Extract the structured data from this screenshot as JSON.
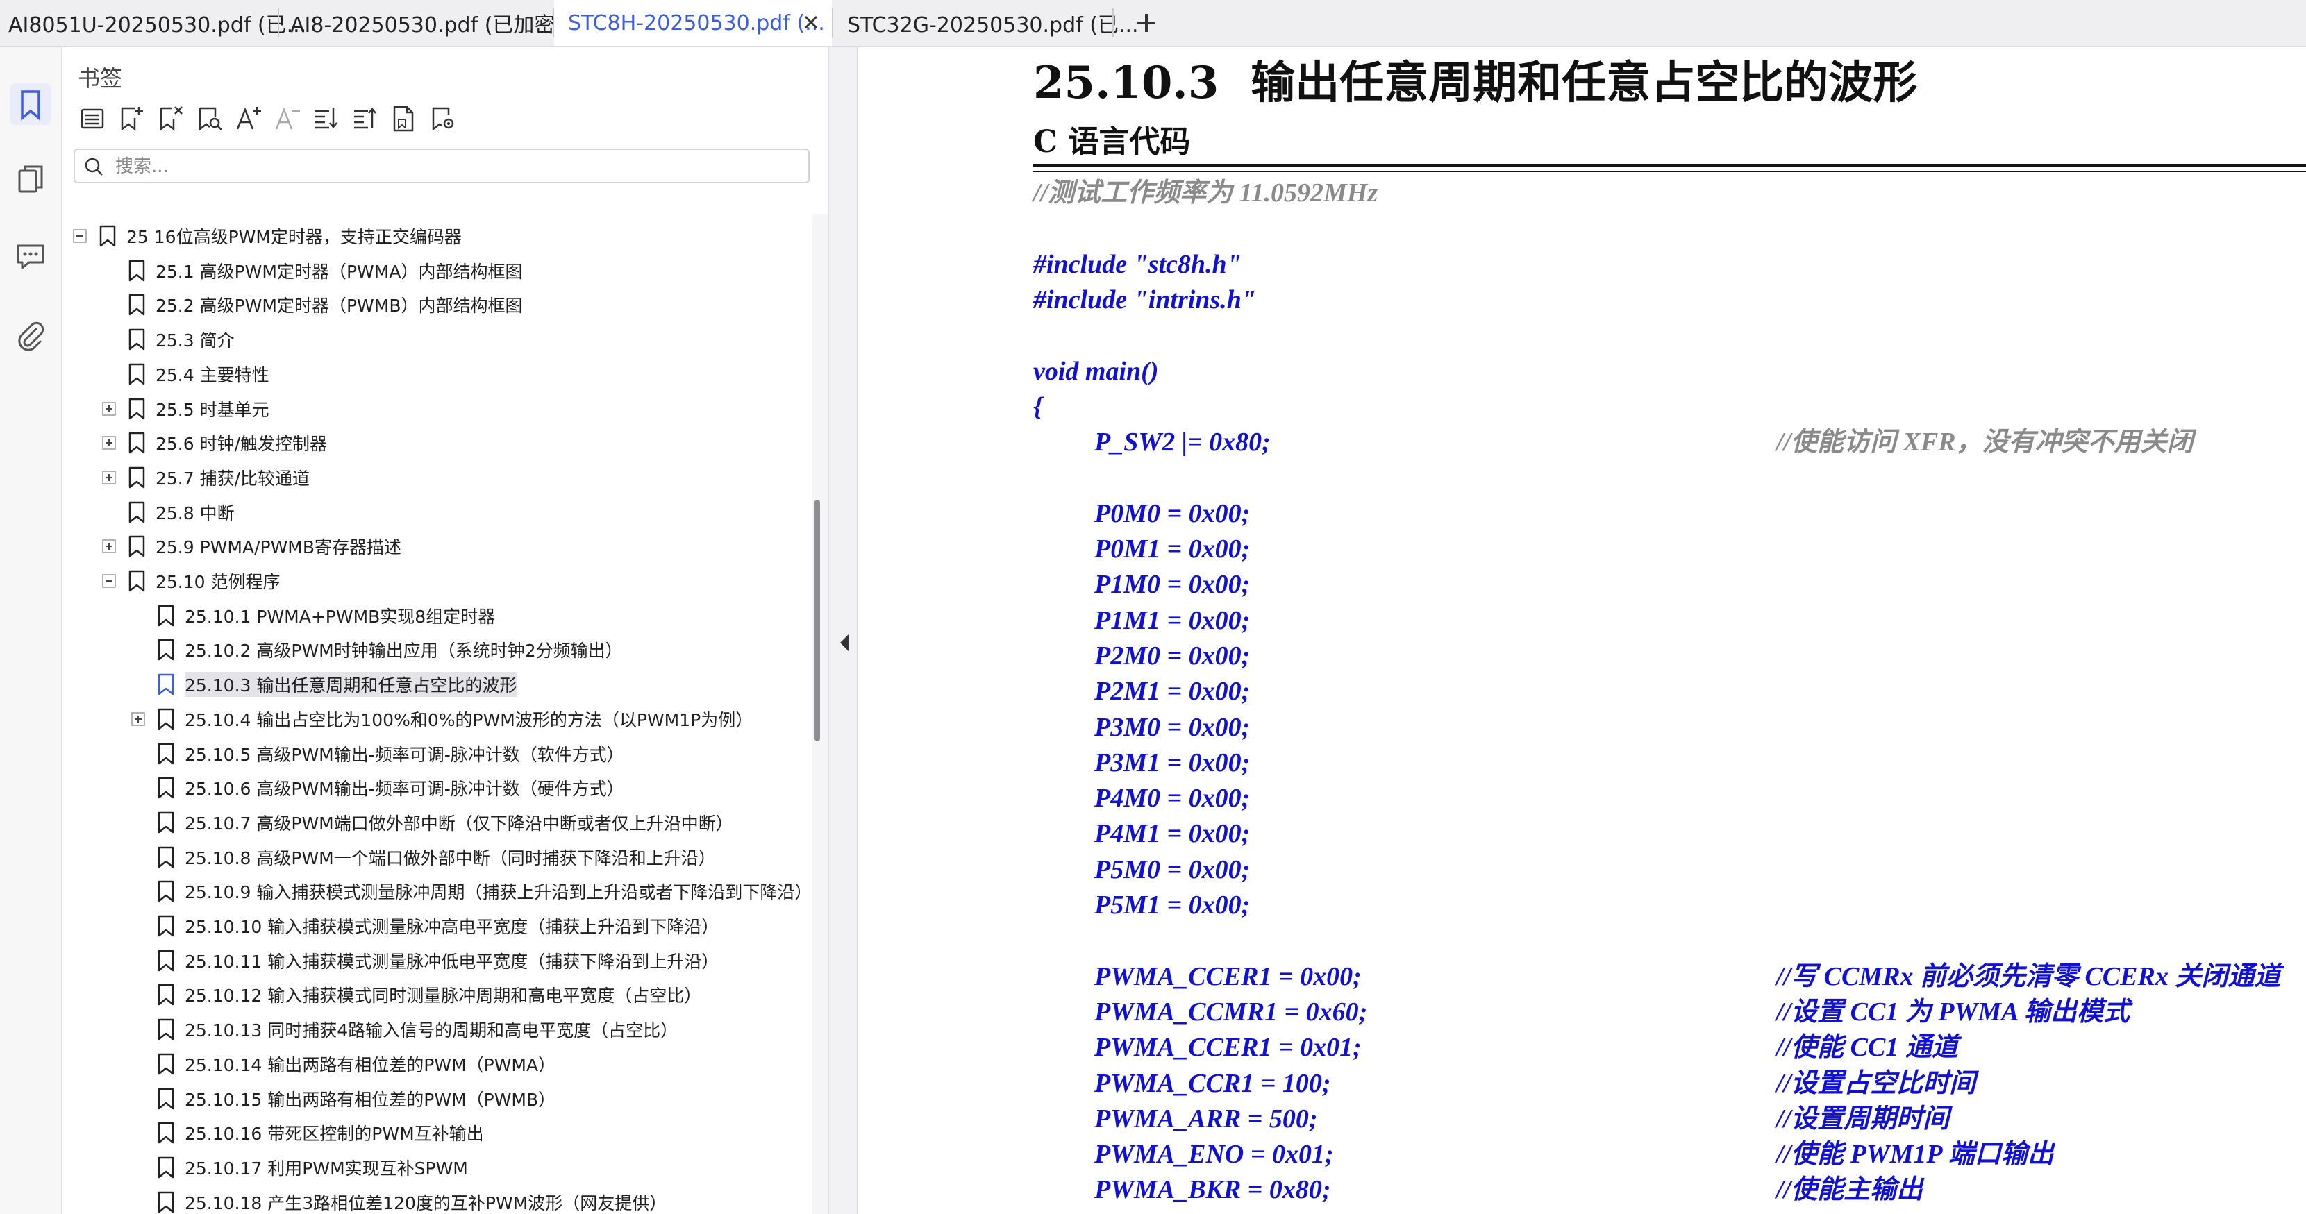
{
  "tabs": [
    {
      "label": "AI8051U-20250530.pdf (已...",
      "active": false
    },
    {
      "label": "AI8-20250530.pdf (已加密)",
      "active": false
    },
    {
      "label": "STC8H-20250530.pdf (...",
      "active": true
    },
    {
      "label": "STC32G-20250530.pdf (已..."
    }
  ],
  "sidebar": {
    "title": "书签",
    "search_placeholder": "搜索...",
    "tools": [
      "list-icon",
      "add-bookmark-icon",
      "delete-bookmark-icon",
      "find-bookmark-icon",
      "font-increase-icon",
      "font-decrease-icon",
      "expand-all-icon",
      "collapse-all-icon",
      "bookmark-page-icon",
      "bookmark-settings-icon"
    ],
    "rail": [
      "bookmark-icon",
      "pages-icon",
      "comments-icon",
      "attachment-icon"
    ],
    "items": [
      {
        "label": "25  16位高级PWM定时器，支持正交编码器",
        "level": 0,
        "expander": "minus"
      },
      {
        "label": "25.1  高级PWM定时器（PWMA）内部结构框图",
        "level": 1,
        "expander": ""
      },
      {
        "label": "25.2  高级PWM定时器（PWMB）内部结构框图",
        "level": 1,
        "expander": ""
      },
      {
        "label": "25.3  简介",
        "level": 1,
        "expander": ""
      },
      {
        "label": "25.4  主要特性",
        "level": 1,
        "expander": ""
      },
      {
        "label": "25.5  时基单元",
        "level": 1,
        "expander": "plus"
      },
      {
        "label": "25.6 时钟/触发控制器",
        "level": 1,
        "expander": "plus"
      },
      {
        "label": "25.7 捕获/比较通道",
        "level": 1,
        "expander": "plus"
      },
      {
        "label": "25.8 中断",
        "level": 1,
        "expander": ""
      },
      {
        "label": "25.9  PWMA/PWMB寄存器描述",
        "level": 1,
        "expander": "plus"
      },
      {
        "label": "25.10  范例程序",
        "level": 1,
        "expander": "minus"
      },
      {
        "label": "25.10.1 PWMA+PWMB实现8组定时器",
        "level": 2,
        "expander": ""
      },
      {
        "label": "25.10.2 高级PWM时钟输出应用（系统时钟2分频输出）",
        "level": 2,
        "expander": ""
      },
      {
        "label": "25.10.3 输出任意周期和任意占空比的波形",
        "level": 2,
        "expander": "",
        "selected": true
      },
      {
        "label": "25.10.4 输出占空比为100%和0%的PWM波形的方法（以PWM1P为例）",
        "level": 2,
        "expander": "plus"
      },
      {
        "label": "25.10.5 高级PWM输出-频率可调-脉冲计数（软件方式）",
        "level": 2,
        "expander": ""
      },
      {
        "label": "25.10.6 高级PWM输出-频率可调-脉冲计数（硬件方式）",
        "level": 2,
        "expander": ""
      },
      {
        "label": "25.10.7 高级PWM端口做外部中断（仅下降沿中断或者仅上升沿中断）",
        "level": 2,
        "expander": ""
      },
      {
        "label": "25.10.8  高级PWM一个端口做外部中断（同时捕获下降沿和上升沿）",
        "level": 2,
        "expander": ""
      },
      {
        "label": "25.10.9  输入捕获模式测量脉冲周期（捕获上升沿到上升沿或者下降沿到下降沿）",
        "level": 2,
        "expander": ""
      },
      {
        "label": "25.10.10 输入捕获模式测量脉冲高电平宽度（捕获上升沿到下降沿）",
        "level": 2,
        "expander": ""
      },
      {
        "label": "25.10.11 输入捕获模式测量脉冲低电平宽度（捕获下降沿到上升沿）",
        "level": 2,
        "expander": ""
      },
      {
        "label": "25.10.12 输入捕获模式同时测量脉冲周期和高电平宽度（占空比）",
        "level": 2,
        "expander": ""
      },
      {
        "label": "25.10.13 同时捕获4路输入信号的周期和高电平宽度（占空比）",
        "level": 2,
        "expander": ""
      },
      {
        "label": "25.10.14 输出两路有相位差的PWM（PWMA）",
        "level": 2,
        "expander": ""
      },
      {
        "label": "25.10.15 输出两路有相位差的PWM（PWMB）",
        "level": 2,
        "expander": ""
      },
      {
        "label": "25.10.16 带死区控制的PWM互补输出",
        "level": 2,
        "expander": ""
      },
      {
        "label": "25.10.17 利用PWM实现互补SPWM",
        "level": 2,
        "expander": ""
      },
      {
        "label": "25.10.18 产生3路相位差120度的互补PWM波形（网友提供）",
        "level": 2,
        "expander": ""
      }
    ]
  },
  "document": {
    "section_number": "25.10.3",
    "section_title": "输出任意周期和任意占空比的波形",
    "subheading": "C 语言代码",
    "lines": [
      {
        "kind": "comment",
        "code": "//测试工作频率为 11.0592MHz",
        "comment": ""
      },
      {
        "kind": "blank",
        "code": "",
        "comment": ""
      },
      {
        "kind": "code",
        "code": "#include \"stc8h.h\"",
        "comment": ""
      },
      {
        "kind": "code",
        "code": "#include \"intrins.h\"",
        "comment": ""
      },
      {
        "kind": "blank",
        "code": "",
        "comment": ""
      },
      {
        "kind": "code",
        "code": "void main()",
        "comment": ""
      },
      {
        "kind": "code",
        "code": "{",
        "comment": ""
      },
      {
        "kind": "code-indent",
        "code": "P_SW2 |= 0x80;",
        "comment": "//使能访问 XFR，没有冲突不用关闭",
        "comment_gray": true
      },
      {
        "kind": "blank",
        "code": "",
        "comment": ""
      },
      {
        "kind": "code-indent",
        "code": "P0M0 = 0x00;",
        "comment": ""
      },
      {
        "kind": "code-indent",
        "code": "P0M1 = 0x00;",
        "comment": ""
      },
      {
        "kind": "code-indent",
        "code": "P1M0 = 0x00;",
        "comment": ""
      },
      {
        "kind": "code-indent",
        "code": "P1M1 = 0x00;",
        "comment": ""
      },
      {
        "kind": "code-indent",
        "code": "P2M0 = 0x00;",
        "comment": ""
      },
      {
        "kind": "code-indent",
        "code": "P2M1 = 0x00;",
        "comment": ""
      },
      {
        "kind": "code-indent",
        "code": "P3M0 = 0x00;",
        "comment": ""
      },
      {
        "kind": "code-indent",
        "code": "P3M1 = 0x00;",
        "comment": ""
      },
      {
        "kind": "code-indent",
        "code": "P4M0 = 0x00;",
        "comment": ""
      },
      {
        "kind": "code-indent",
        "code": "P4M1 = 0x00;",
        "comment": ""
      },
      {
        "kind": "code-indent",
        "code": "P5M0 = 0x00;",
        "comment": ""
      },
      {
        "kind": "code-indent",
        "code": "P5M1 = 0x00;",
        "comment": ""
      },
      {
        "kind": "blank",
        "code": "",
        "comment": ""
      },
      {
        "kind": "code-indent",
        "code": "PWMA_CCER1 = 0x00;",
        "comment": "//写 CCMRx 前必须先清零 CCERx 关闭通道"
      },
      {
        "kind": "code-indent",
        "code": "PWMA_CCMR1 = 0x60;",
        "comment": "//设置 CC1 为 PWMA 输出模式"
      },
      {
        "kind": "code-indent",
        "code": "PWMA_CCER1 = 0x01;",
        "comment": "//使能 CC1 通道"
      },
      {
        "kind": "code-indent",
        "code": "PWMA_CCR1 = 100;",
        "comment": "//设置占空比时间"
      },
      {
        "kind": "code-indent",
        "code": "PWMA_ARR = 500;",
        "comment": "//设置周期时间"
      },
      {
        "kind": "code-indent",
        "code": "PWMA_ENO = 0x01;",
        "comment": "//使能 PWM1P 端口输出"
      },
      {
        "kind": "code-indent",
        "code": "PWMA_BKR = 0x80;",
        "comment": "//使能主输出"
      }
    ]
  },
  "colors": {
    "accent": "#3d5de0",
    "code": "#1111d6",
    "comment_gray": "#8a8a8a"
  }
}
